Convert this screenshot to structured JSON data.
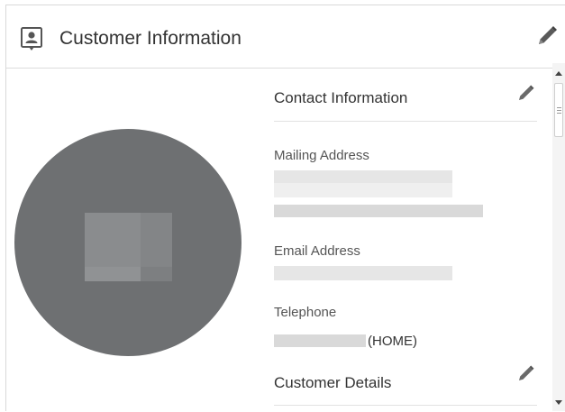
{
  "header": {
    "title": "Customer Information",
    "icon": "contact-card-icon",
    "edit_icon": "pencil-icon"
  },
  "avatar": {
    "icon": "customer-photo-placeholder"
  },
  "contact_section": {
    "title": "Contact Information",
    "edit_icon": "pencil-icon",
    "fields": [
      {
        "label": "Mailing Address"
      },
      {
        "label": "Email Address"
      },
      {
        "label": "Telephone",
        "suffix": "(HOME)"
      }
    ]
  },
  "details_section": {
    "title": "Customer Details",
    "edit_icon": "pencil-icon"
  },
  "colors": {
    "avatar_bg": "#6e7072",
    "text": "#333333",
    "border": "#d9d9d9"
  }
}
